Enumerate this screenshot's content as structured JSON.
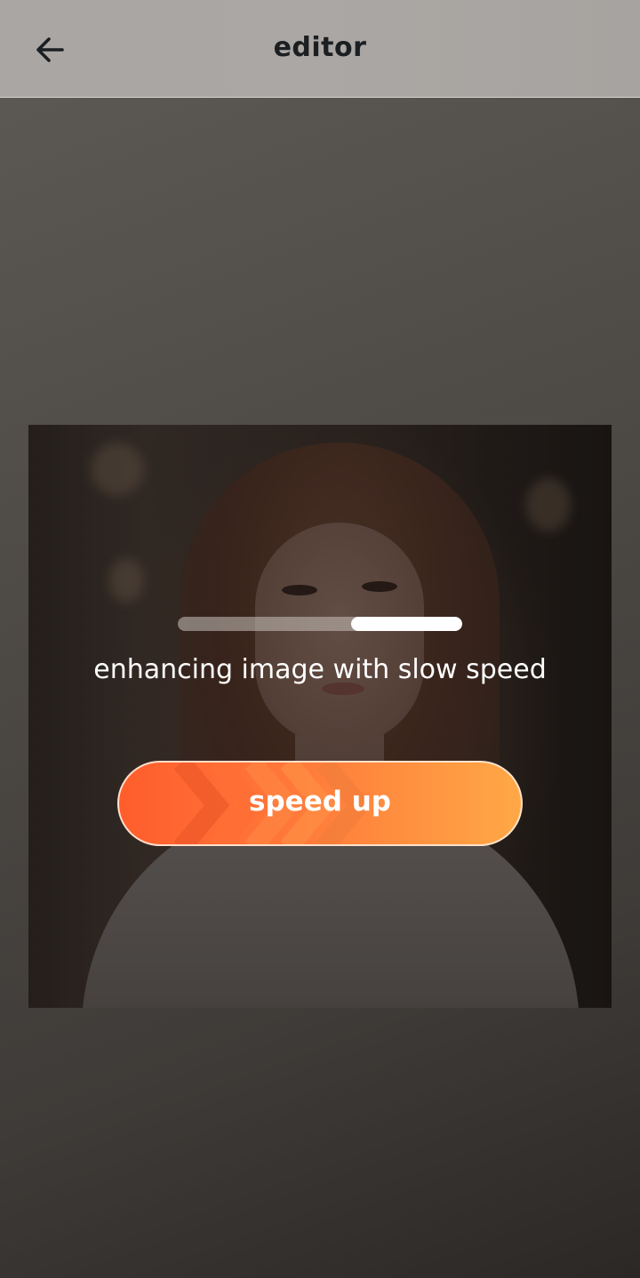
{
  "appbar": {
    "title": "editor",
    "back_icon": "arrow-left-icon"
  },
  "editor": {
    "status_text": "enhancing image with slow speed",
    "progress": {
      "start_fraction": 0.61,
      "end_fraction": 1.0
    },
    "speed_button": {
      "label": "speed up",
      "icon": "chevrons-right-icon",
      "gradient_start": "#ff5d2c",
      "gradient_end": "#ffa846"
    }
  }
}
